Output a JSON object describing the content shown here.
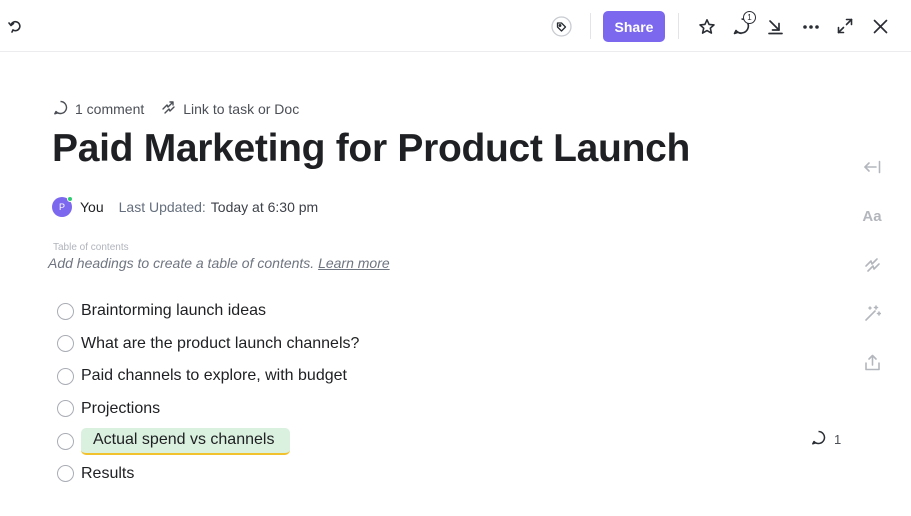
{
  "toolbar": {
    "share_label": "Share",
    "comment_badge": "1",
    "icons": [
      "sync-icon",
      "tag-icon",
      "star-icon",
      "comment-icon",
      "collapse-icon",
      "more-icon",
      "expand-icon",
      "close-icon"
    ]
  },
  "doc": {
    "comment_link": "1 comment",
    "link_task": "Link to task or Doc",
    "title": "Paid Marketing for Product Launch",
    "author": {
      "avatar_initial": "P",
      "name": "You",
      "updated_label": "Last Updated:",
      "updated_value": "Today at 6:30 pm"
    },
    "toc": {
      "label": "Table of contents",
      "hint": "Add headings to create a table of contents.",
      "link": "Learn more"
    },
    "checklist": [
      {
        "text": "Braintorming launch ideas",
        "checked": false
      },
      {
        "text": "What are the product launch channels?",
        "checked": false
      },
      {
        "text": "Paid channels to explore, with budget",
        "checked": false
      },
      {
        "text": "Projections",
        "checked": false
      },
      {
        "text": "Actual spend vs channels",
        "checked": false,
        "highlighted": true,
        "comments": "1"
      },
      {
        "text": "Results",
        "checked": false
      }
    ]
  },
  "side_tools": {
    "font_label": "Aa",
    "icons": [
      "collapse-left-icon",
      "font-icon",
      "link-icon",
      "magic-wand-icon",
      "export-icon"
    ]
  },
  "colors": {
    "accent": "#7b68ee",
    "highlight_bg": "#dbf1df",
    "highlight_underline": "#f2c12e",
    "online": "#2ecc71"
  }
}
